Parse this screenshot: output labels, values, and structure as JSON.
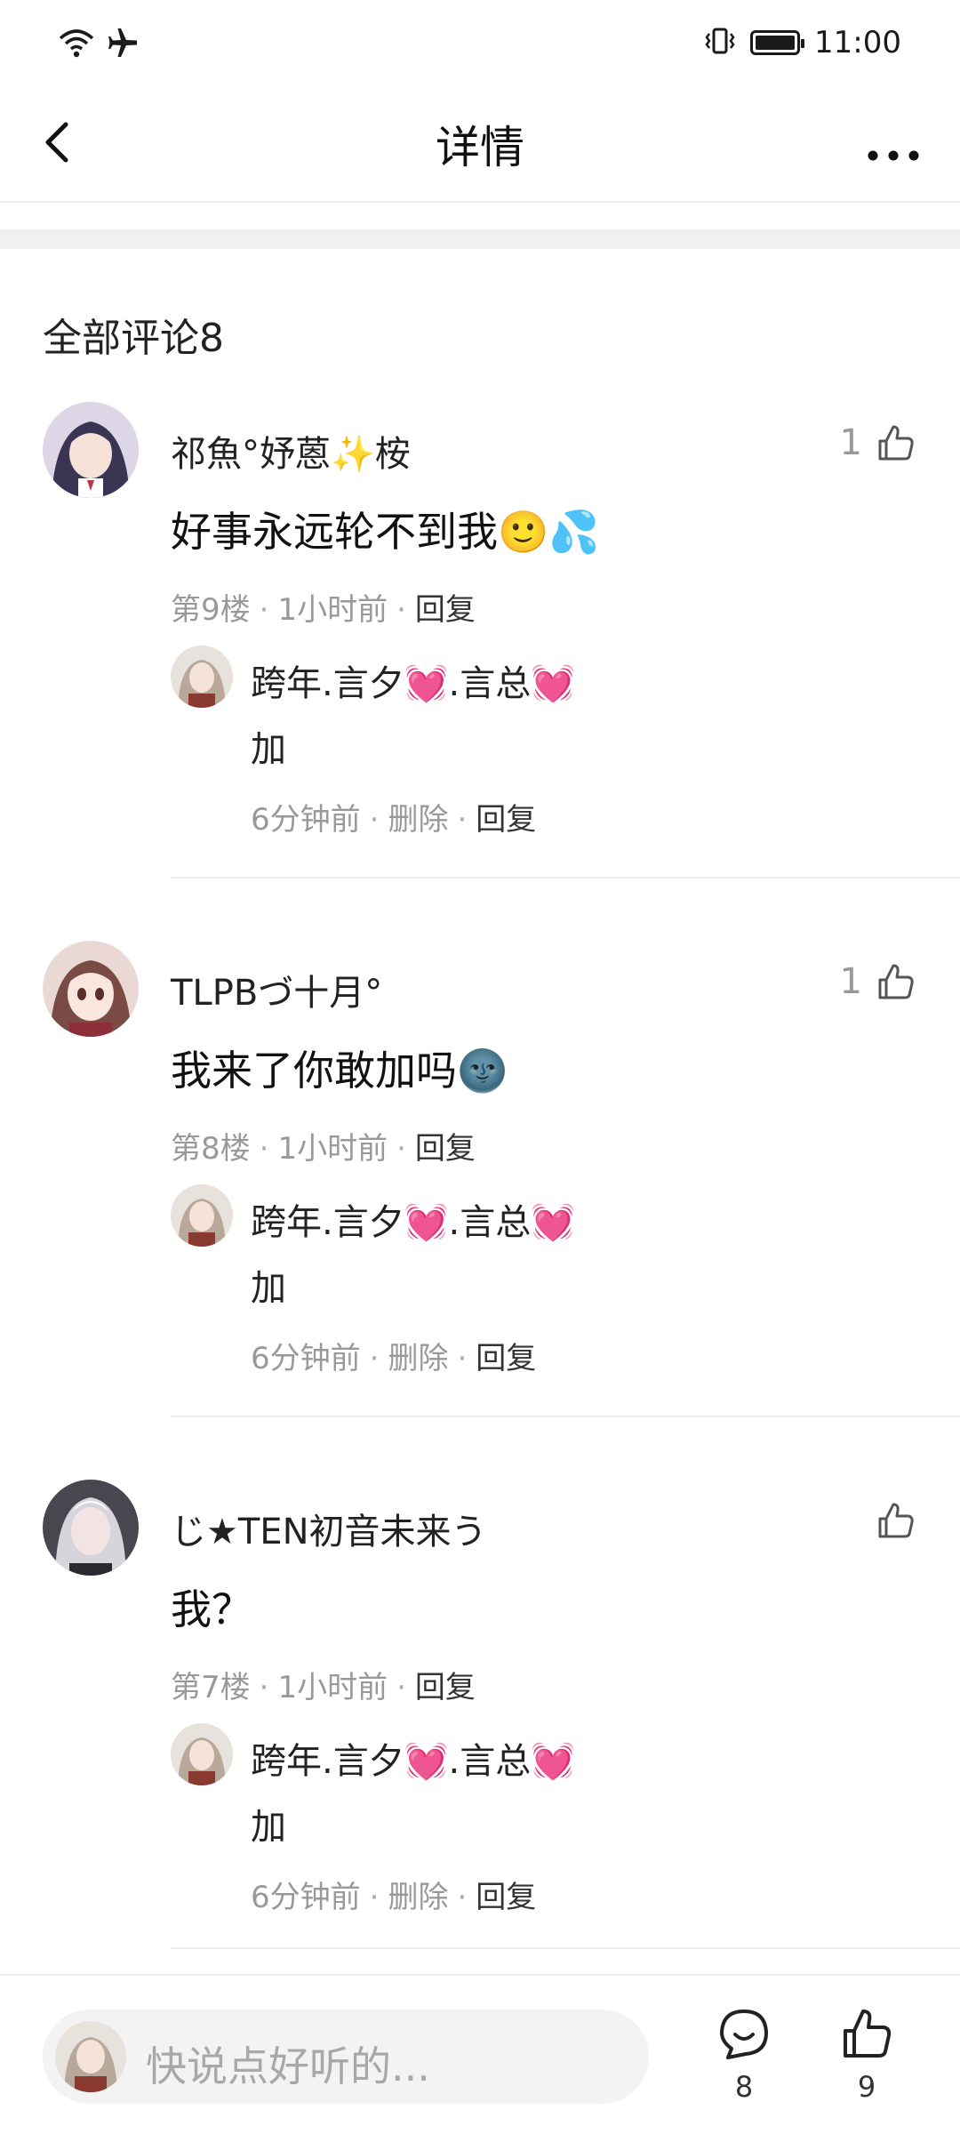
{
  "status_bar": {
    "time": "11:00",
    "icons": [
      "wifi-icon",
      "airplane-icon",
      "vibrate-icon",
      "battery-icon"
    ]
  },
  "header": {
    "title": "详情",
    "back_icon": "chevron-left-icon",
    "more_icon": "more-dots-icon"
  },
  "comments_section": {
    "title": "全部评论8"
  },
  "comments": [
    {
      "name": "祁魚°妤蒽✨桉",
      "text": "好事永远轮不到我🙂💦",
      "like_count": "1",
      "floor": "第9楼",
      "time": "1小时前",
      "reply_label": "回复",
      "reply": {
        "name": "跨年.言夕💓.言总💓",
        "text": "加",
        "time": "6分钟前",
        "delete_label": "删除",
        "reply_label": "回复"
      }
    },
    {
      "name": "TLPBづ十月°",
      "text": "我来了你敢加吗🌚",
      "like_count": "1",
      "floor": "第8楼",
      "time": "1小时前",
      "reply_label": "回复",
      "reply": {
        "name": "跨年.言夕💓.言总💓",
        "text": "加",
        "time": "6分钟前",
        "delete_label": "删除",
        "reply_label": "回复"
      }
    },
    {
      "name": "じ★TEN初音未来う",
      "text": "我？",
      "like_count": "",
      "floor": "第7楼",
      "time": "1小时前",
      "reply_label": "回复",
      "reply": {
        "name": "跨年.言夕💓.言总💓",
        "text": "加",
        "time": "6分钟前",
        "delete_label": "删除",
        "reply_label": "回复"
      }
    }
  ],
  "bottom_bar": {
    "input_placeholder": "快说点好听的...",
    "comment_count": "8",
    "like_count": "9"
  }
}
